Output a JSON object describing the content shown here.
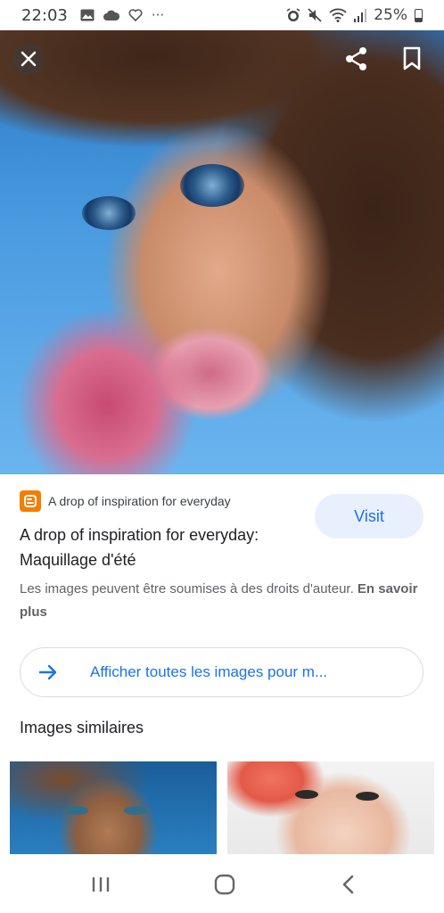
{
  "status_bar": {
    "time": "22:03",
    "left_icons": [
      "gallery-icon",
      "cloud-icon",
      "heart-icon",
      "more-icon"
    ],
    "more_glyph": "···",
    "right_icons": [
      "alarm-icon",
      "mute-icon",
      "wifi-icon",
      "signal-icon"
    ],
    "battery": "25%"
  },
  "hero": {
    "close_icon": "close-icon",
    "share_icon": "share-icon",
    "bookmark_icon": "bookmark-icon"
  },
  "source": {
    "logo_icon": "blogger-icon",
    "logo_letter": "B",
    "name": "A drop of inspiration for everyday",
    "brand_color": "#f57d00"
  },
  "visit_label": "Visit",
  "title_line1": "A drop of inspiration for everyday:",
  "title_line2": "Maquillage d'été",
  "copyright": {
    "text": "Les images peuvent être soumises à des droits d'auteur. ",
    "link": "En savoir plus"
  },
  "view_all": {
    "icon": "arrow-right-icon",
    "label": "Afficher toutes les images pour m..."
  },
  "similar_title": "Images similaires",
  "nav_bar": {
    "recents_icon": "recents-icon",
    "home_icon": "home-icon",
    "back_icon": "back-icon"
  },
  "colors": {
    "accent": "#1a73e8",
    "visit_bg": "#e8f0fe"
  }
}
